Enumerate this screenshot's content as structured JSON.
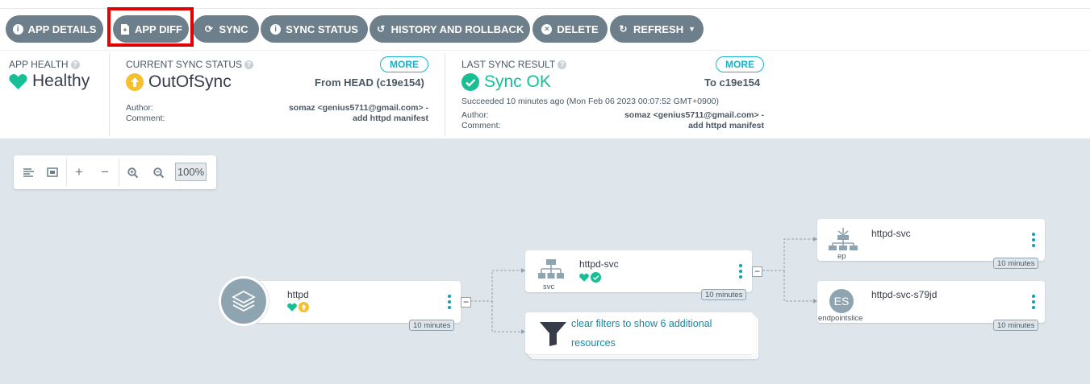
{
  "toolbar": {
    "buttons": [
      {
        "label": "APP DETAILS",
        "icon": "info-circle-icon"
      },
      {
        "label": "APP DIFF",
        "icon": "file-diff-icon"
      },
      {
        "label": "SYNC",
        "icon": "sync-icon"
      },
      {
        "label": "SYNC STATUS",
        "icon": "info-circle-icon"
      },
      {
        "label": "HISTORY AND ROLLBACK",
        "icon": "history-icon"
      },
      {
        "label": "DELETE",
        "icon": "close-circle-icon"
      },
      {
        "label": "REFRESH",
        "icon": "refresh-icon"
      }
    ],
    "highlighted_button": "APP DIFF",
    "highlight_color": "#e30000"
  },
  "status": {
    "app_health": {
      "heading": "APP HEALTH",
      "value": "Healthy",
      "color": "#18be94"
    },
    "current_sync": {
      "heading": "CURRENT SYNC STATUS",
      "value": "OutOfSync",
      "color": "#f4c030",
      "more": "MORE",
      "ref": "From HEAD (c19e154)",
      "author_label": "Author:",
      "author": "somaz <genius5711@gmail.com> -",
      "comment_label": "Comment:",
      "comment": "add httpd manifest"
    },
    "last_sync": {
      "heading": "LAST SYNC RESULT",
      "value": "Sync OK",
      "color": "#18be94",
      "more": "MORE",
      "ref": "To c19e154",
      "succeeded": "Succeeded 10 minutes ago (Mon Feb 06 2023 00:07:52 GMT+0900)",
      "author_label": "Author:",
      "author": "somaz <genius5711@gmail.com> -",
      "comment_label": "Comment:",
      "comment": "add httpd manifest"
    }
  },
  "zoom": {
    "level": "100%"
  },
  "graph": {
    "app": {
      "name": "httpd",
      "age": "10 minutes"
    },
    "svc": {
      "name": "httpd-svc",
      "kind": "svc",
      "age": "10 minutes"
    },
    "filter": {
      "line1": "clear filters to show 6 additional",
      "line2": "resources"
    },
    "ep": {
      "name": "httpd-svc",
      "kind": "ep",
      "age": "10 minutes"
    },
    "es": {
      "name": "httpd-svc-s79jd",
      "kind": "endpointslice",
      "badge": "ES",
      "age": "10 minutes"
    }
  }
}
